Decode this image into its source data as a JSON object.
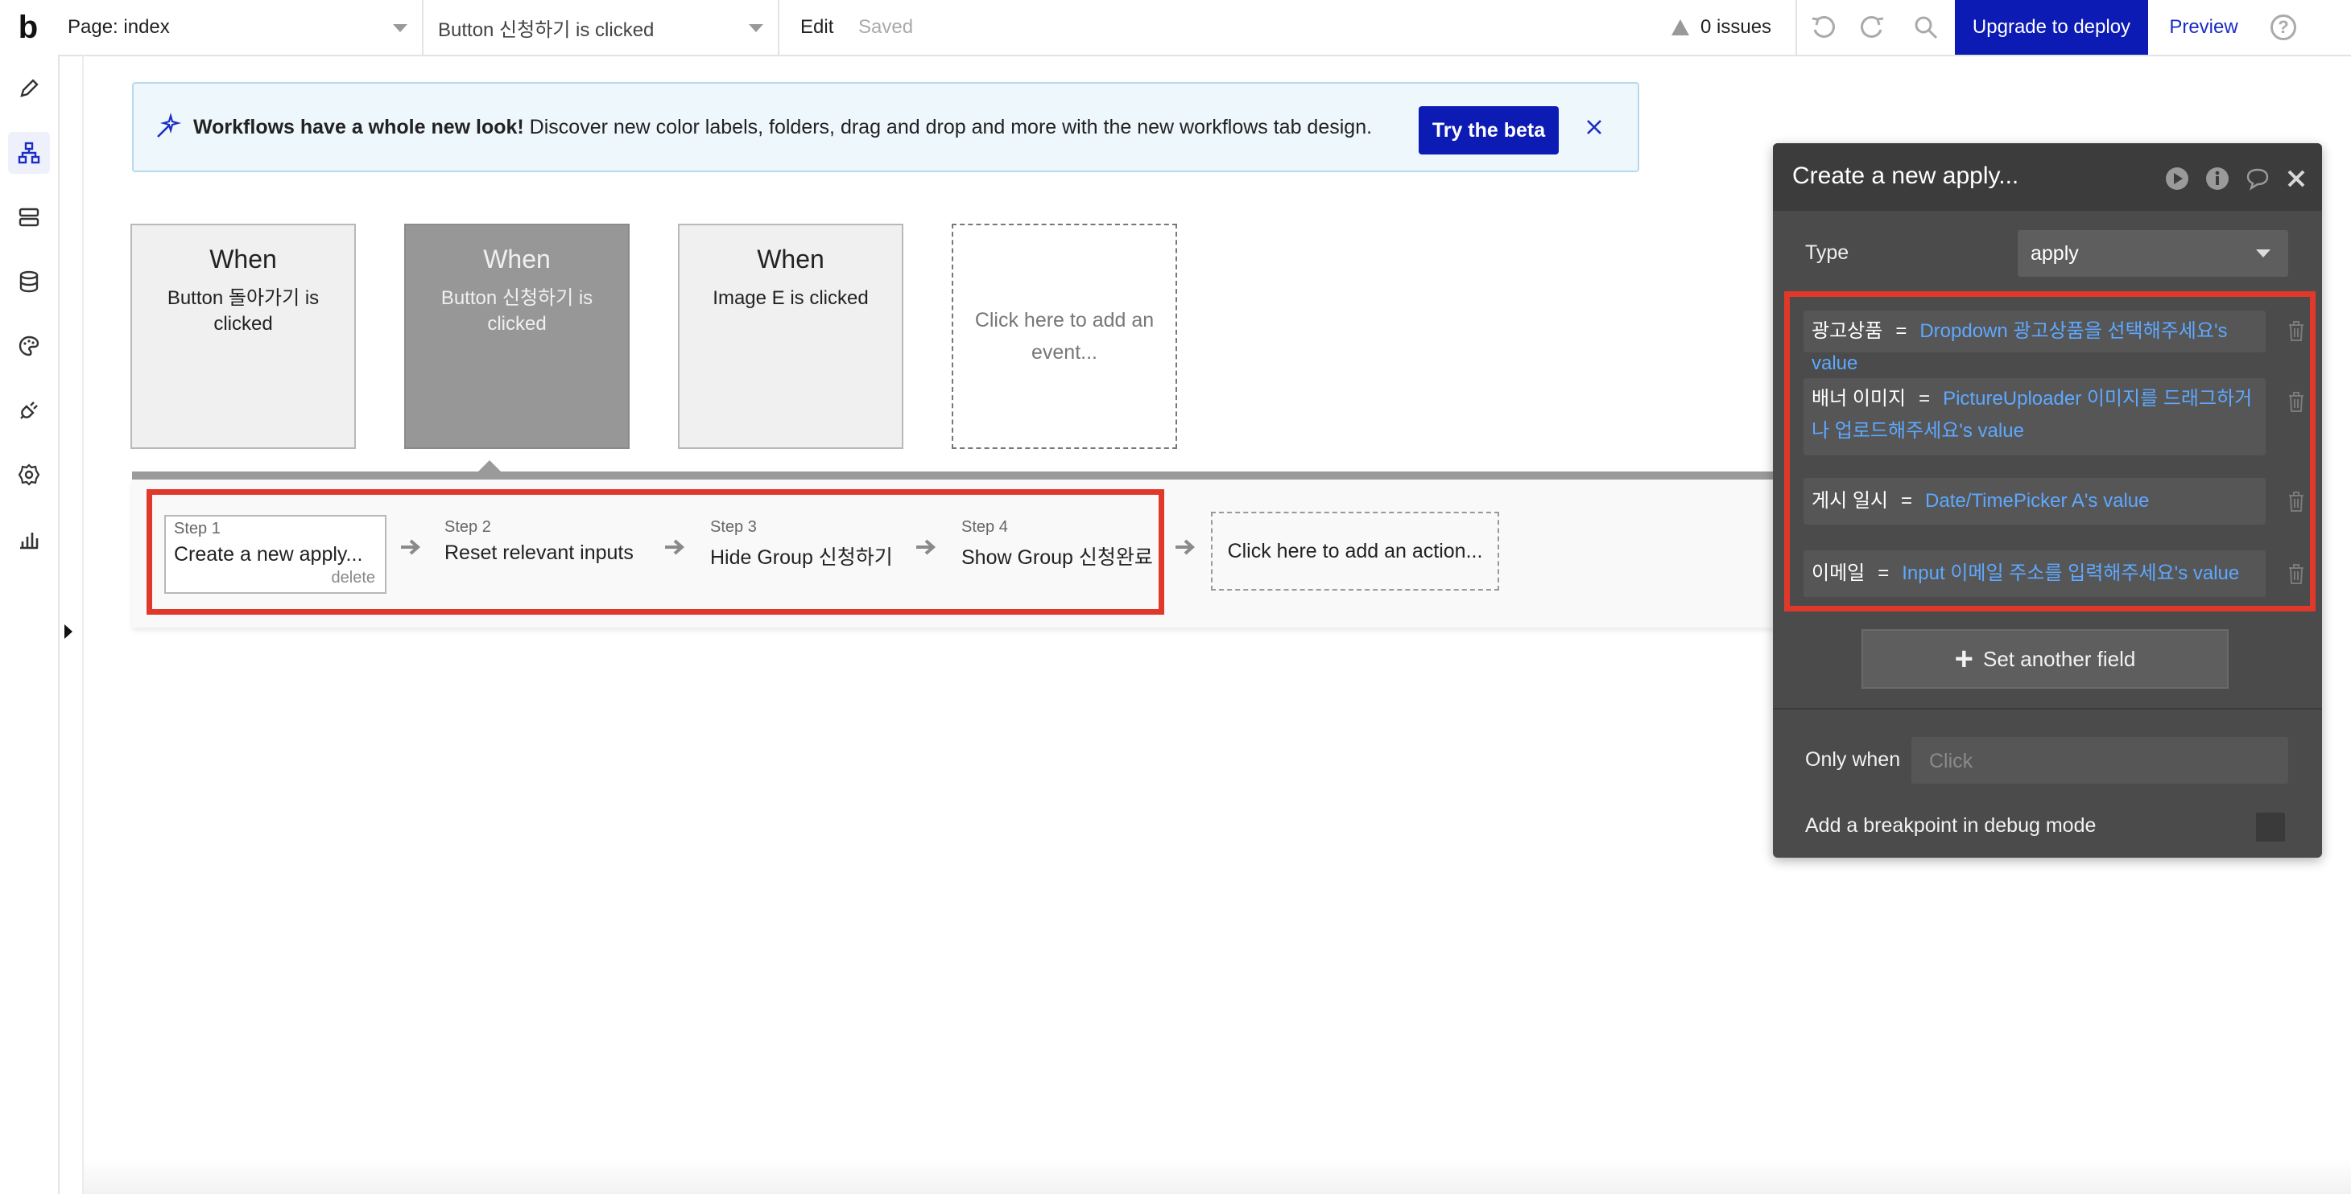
{
  "topbar": {
    "logo": "b",
    "page_select": "Page: index",
    "event_select": "Button 신청하기 is clicked",
    "edit": "Edit",
    "status": "Saved",
    "issues": "0 issues",
    "upgrade": "Upgrade to deploy",
    "preview": "Preview",
    "icons": [
      "undo-icon",
      "redo-icon",
      "search-icon",
      "help-icon"
    ]
  },
  "sidebar": {
    "items": [
      "pencil-icon",
      "workflow-icon",
      "server-icon",
      "database-icon",
      "palette-icon",
      "plugin-icon",
      "settings-icon",
      "analytics-icon"
    ],
    "active": "workflow-icon"
  },
  "banner": {
    "title": "Workflows have a whole new look!",
    "body": " Discover new color labels, folders, drag and drop and more with the new workflows tab design.",
    "cta": "Try the beta"
  },
  "events": [
    {
      "when": "When",
      "desc": "Button 돌아가기 is clicked",
      "selected": false
    },
    {
      "when": "When",
      "desc": "Button 신청하기 is clicked",
      "selected": true
    },
    {
      "when": "When",
      "desc": "Image E is clicked",
      "selected": false
    }
  ],
  "add_event": "Click here to add an event...",
  "steps": [
    {
      "num": "Step 1",
      "name": "Create a new apply...",
      "delete": "delete"
    },
    {
      "num": "Step 2",
      "name": "Reset relevant inputs"
    },
    {
      "num": "Step 3",
      "name": "Hide Group 신청하기"
    },
    {
      "num": "Step 4",
      "name": "Show Group 신청완료"
    }
  ],
  "add_action": "Click here to add an action...",
  "panel": {
    "title": "Create a new apply...",
    "type_label": "Type",
    "type_value": "apply",
    "eq": "=",
    "fields": [
      {
        "name": "광고상품",
        "value": "Dropdown 광고상품을 선택해주세요's value"
      },
      {
        "name": "배너 이미지",
        "value": "PictureUploader 이미지를 드래그하거나 업로드해주세요's value"
      },
      {
        "name": "게시 일시",
        "value": "Date/TimePicker A's value"
      },
      {
        "name": "이메일",
        "value": "Input 이메일 주소를 입력해주세요's value"
      }
    ],
    "set_another": "Set another field",
    "only_when": "Only when",
    "only_when_placeholder": "Click",
    "breakpoint": "Add a breakpoint in debug mode"
  },
  "colors": {
    "accent": "#0d1bb5",
    "highlight": "#e0392b",
    "panel_bg": "#4b4b4b",
    "link_value": "#5ea8ff"
  }
}
